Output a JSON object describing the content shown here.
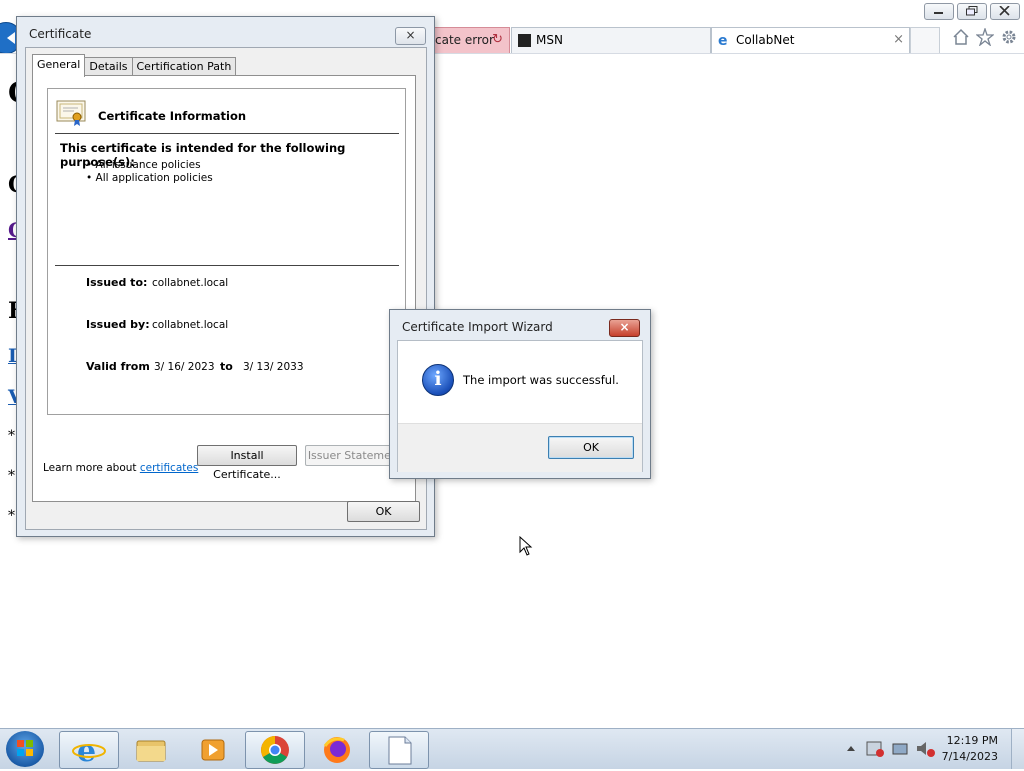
{
  "browser": {
    "tabs": [
      {
        "label": "cate error",
        "state": "error"
      },
      {
        "label": "MSN"
      },
      {
        "label": "CollabNet",
        "close": "×"
      }
    ],
    "page_fragments": [
      "C",
      "C",
      "C",
      "F",
      "I",
      "V",
      "*",
      "*",
      "*"
    ]
  },
  "cert_dialog": {
    "title": "Certificate",
    "close": "×",
    "tabs": [
      "General",
      "Details",
      "Certification Path"
    ],
    "active_tab": "General",
    "info_title": "Certificate Information",
    "purpose_heading": "This certificate is intended for the following purpose(s):",
    "purposes": [
      "• All issuance policies",
      "• All application policies"
    ],
    "issued_to_label": "Issued to:",
    "issued_to": "collabnet.local",
    "issued_by_label": "Issued by:",
    "issued_by": "collabnet.local",
    "valid_from_label": "Valid from",
    "valid_from": "3/ 16/ 2023",
    "to_label": "to",
    "valid_to": "3/ 13/ 2033",
    "install_button": "Install Certificate...",
    "issuer_statement_button": "Issuer Statement",
    "learn_more_prefix": "Learn more about",
    "learn_more_link": "certificates",
    "ok_button": "OK"
  },
  "wizard": {
    "title": "Certificate Import Wizard",
    "close": "×",
    "message": "The import was successful.",
    "ok_button": "OK",
    "icon": "information-icon"
  },
  "taskbar": {
    "time": "12:19 PM",
    "date": "7/14/2023",
    "apps": [
      "internet-explorer",
      "file-explorer",
      "media-player",
      "chrome",
      "firefox",
      "notepad"
    ]
  }
}
